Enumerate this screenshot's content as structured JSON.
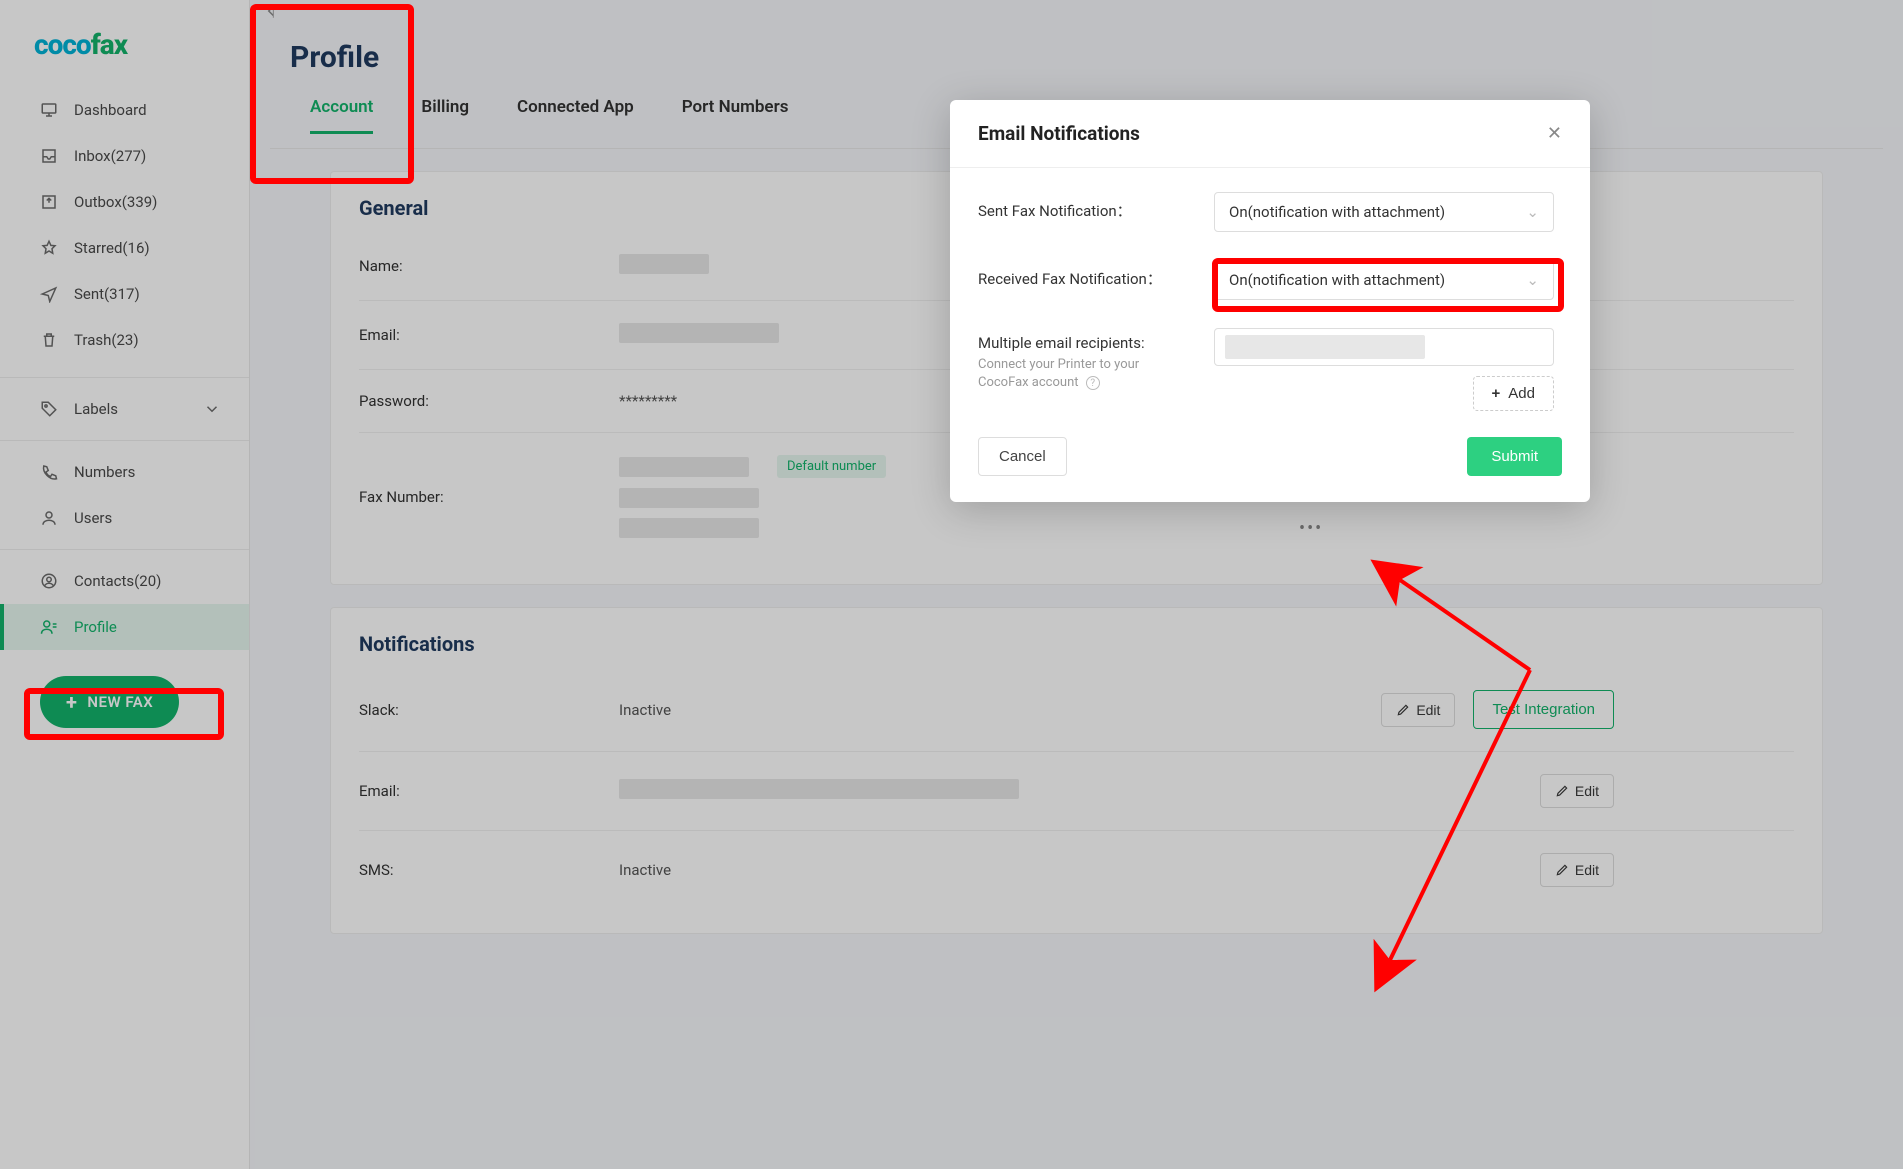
{
  "brand": {
    "part1": "coco",
    "part2": "fax"
  },
  "sidebar": {
    "items": [
      {
        "label": "Dashboard"
      },
      {
        "label": "Inbox(277)"
      },
      {
        "label": "Outbox(339)"
      },
      {
        "label": "Starred(16)"
      },
      {
        "label": "Sent(317)"
      },
      {
        "label": "Trash(23)"
      }
    ],
    "labels_label": "Labels",
    "numbers_label": "Numbers",
    "users_label": "Users",
    "contacts_label": "Contacts(20)",
    "profile_label": "Profile",
    "new_fax_label": "NEW FAX"
  },
  "page": {
    "title": "Profile",
    "tabs": {
      "account": "Account",
      "billing": "Billing",
      "connected": "Connected App",
      "port": "Port Numbers"
    }
  },
  "general": {
    "heading": "General",
    "name_label": "Name:",
    "email_label": "Email:",
    "password_label": "Password:",
    "password_value": "*********",
    "fax_label": "Fax Number:",
    "default_badge": "Default number"
  },
  "notifications": {
    "heading": "Notifications",
    "slack_label": "Slack:",
    "slack_value": "Inactive",
    "email_label": "Email:",
    "sms_label": "SMS:",
    "sms_value": "Inactive",
    "edit_label": "Edit",
    "test_label": "Test Integration"
  },
  "modal": {
    "title": "Email Notifications",
    "sent_label": "Sent Fax Notification：",
    "sent_value": "On(notification with attachment)",
    "received_label": "Received Fax Notification：",
    "received_value": "On(notification with attachment)",
    "recipients_label": "Multiple email recipients:",
    "recipients_help1": "Connect your Printer to your",
    "recipients_help2": "CocoFax account",
    "add_label": "Add",
    "cancel_label": "Cancel",
    "submit_label": "Submit"
  },
  "annotations": {
    "boxes": [
      {
        "name": "profile-title-highlight"
      },
      {
        "name": "sidebar-profile-highlight"
      },
      {
        "name": "received-select-highlight"
      }
    ],
    "arrows": "two red arrows pointing to Edit buttons from the received-select dropdown"
  }
}
